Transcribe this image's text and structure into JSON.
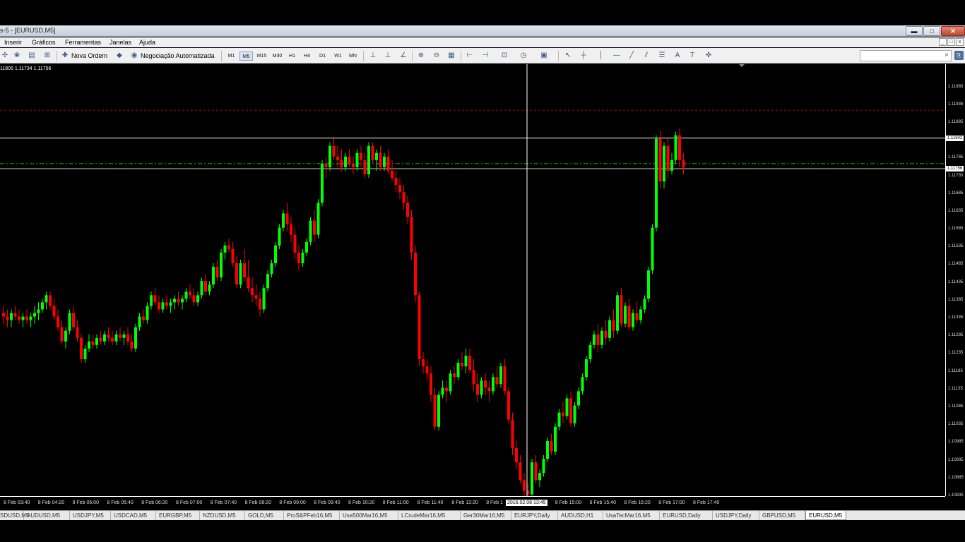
{
  "window": {
    "title": "s-5 - [EURUSD,M5]",
    "buttons": {
      "minimize": "▬",
      "maximize": "□",
      "close": "✕"
    }
  },
  "menu": {
    "items": [
      "Inserir",
      "Gráficos",
      "Ferramentas",
      "Janelas",
      "Ajuda"
    ],
    "mdi_buttons": [
      "_",
      "□",
      "x"
    ]
  },
  "toolbar": {
    "new_order": "Nova Ordem",
    "auto_trading": "Negociação Automatizada",
    "timeframes": [
      "M1",
      "M5",
      "M15",
      "M30",
      "H1",
      "H4",
      "D1",
      "W1",
      "MN"
    ],
    "active_timeframe": "M5",
    "icons": {
      "new-chart": "✢",
      "profiles": "❀",
      "market-watch": "▤",
      "navigator": "⊞",
      "new-order": "✚",
      "expert": "◆",
      "auto-trading": "◉",
      "bar-chart": "⊥",
      "candlesticks": "⊥",
      "line-chart": "∠",
      "zoom-in": "⊕",
      "zoom-out": "⊖",
      "tile-windows": "▦",
      "chart-shift": "⊢",
      "autoscroll": "⊣",
      "indicators": "⊡",
      "periods": "◷",
      "templates": "▣",
      "cursor": "↖",
      "crosshair": "┼",
      "vertical-line": "│",
      "horizontal-line": "—",
      "trendline": "╱",
      "equidistant-channel": "⫽",
      "fibonacci": "☰",
      "text": "A",
      "text-label": "T",
      "arrows": "✜",
      "search": "⌕",
      "signals": "⎘"
    }
  },
  "chart": {
    "ohlc": "11805 1.11734 1.11756",
    "crosshair_time": "2016.02.08 13:45",
    "price_tags": {
      "crosshair": "1.11842",
      "bid": "1.11756"
    }
  },
  "chart_data": {
    "type": "candlestick",
    "symbol": "EURUSD",
    "timeframe": "M5",
    "ylim": [
      1.10835,
      1.12
    ],
    "y_ticks": [
      "1.11985",
      "1.11935",
      "1.11885",
      "1.11785",
      "1.11735",
      "1.11685",
      "1.11635",
      "1.11585",
      "1.11535",
      "1.11485",
      "1.11435",
      "1.11385",
      "1.11335",
      "1.11285",
      "1.11235",
      "1.11185",
      "1.11135",
      "1.11085",
      "1.11035",
      "1.10985",
      "1.10935",
      "1.10885",
      "1.10835"
    ],
    "x_ticks": [
      "8 Feb 03:40",
      "8 Feb 04:20",
      "8 Feb 05:00",
      "8 Feb 05:40",
      "8 Feb 06:20",
      "8 Feb 07:00",
      "8 Feb 07:40",
      "8 Feb 08:20",
      "8 Feb 09:00",
      "8 Feb 09:40",
      "8 Feb 10:20",
      "8 Feb 11:00",
      "8 Feb 11:40",
      "8 Feb 12:20",
      "8 Feb 1",
      "8 Feb 14:20",
      "8 Feb 15:00",
      "8 Feb 15:40",
      "8 Feb 16:20",
      "8 Feb 17:00",
      "8 Feb 17:40"
    ],
    "lines": {
      "red_dashed": 1.1192,
      "crosshair_price": 1.11842,
      "green_dashdot": 1.1177,
      "bid": 1.11756
    },
    "colors": {
      "bull": "#00ff00",
      "bear": "#ff0000",
      "background": "#000000",
      "axis": "#ffffff"
    },
    "ohlc": [
      [
        1.1135,
        1.1137,
        1.1132,
        1.1134
      ],
      [
        1.1134,
        1.1136,
        1.1131,
        1.1133
      ],
      [
        1.1133,
        1.1136,
        1.1131,
        1.1135
      ],
      [
        1.1135,
        1.1137,
        1.1133,
        1.1134
      ],
      [
        1.1134,
        1.1136,
        1.1132,
        1.1133
      ],
      [
        1.1133,
        1.1135,
        1.1131,
        1.1134
      ],
      [
        1.1134,
        1.1136,
        1.1132,
        1.1133
      ],
      [
        1.1133,
        1.1135,
        1.1131,
        1.1134
      ],
      [
        1.1134,
        1.1137,
        1.1132,
        1.1135
      ],
      [
        1.1135,
        1.1138,
        1.1133,
        1.1136
      ],
      [
        1.1136,
        1.1139,
        1.1135,
        1.1138
      ],
      [
        1.1138,
        1.1141,
        1.1136,
        1.114
      ],
      [
        1.114,
        1.1141,
        1.1136,
        1.1137
      ],
      [
        1.1137,
        1.1139,
        1.1133,
        1.1134
      ],
      [
        1.1134,
        1.1136,
        1.113,
        1.1131
      ],
      [
        1.1131,
        1.1133,
        1.1126,
        1.1127
      ],
      [
        1.1127,
        1.1131,
        1.1125,
        1.113
      ],
      [
        1.113,
        1.1136,
        1.1129,
        1.1135
      ],
      [
        1.1135,
        1.1137,
        1.113,
        1.1131
      ],
      [
        1.1131,
        1.1133,
        1.1127,
        1.1128
      ],
      [
        1.1128,
        1.1129,
        1.1121,
        1.1122
      ],
      [
        1.1122,
        1.1126,
        1.1121,
        1.1125
      ],
      [
        1.1125,
        1.1129,
        1.1124,
        1.1127
      ],
      [
        1.1127,
        1.1129,
        1.1125,
        1.1126
      ],
      [
        1.1126,
        1.1129,
        1.1125,
        1.1128
      ],
      [
        1.1128,
        1.113,
        1.1126,
        1.1127
      ],
      [
        1.1127,
        1.113,
        1.1126,
        1.1129
      ],
      [
        1.1129,
        1.1131,
        1.1127,
        1.1128
      ],
      [
        1.1128,
        1.113,
        1.1126,
        1.1127
      ],
      [
        1.1127,
        1.113,
        1.1126,
        1.1129
      ],
      [
        1.1129,
        1.1131,
        1.1127,
        1.1128
      ],
      [
        1.1128,
        1.113,
        1.1126,
        1.1129
      ],
      [
        1.1129,
        1.1131,
        1.1126,
        1.1127
      ],
      [
        1.1127,
        1.1129,
        1.1124,
        1.1125
      ],
      [
        1.1125,
        1.1132,
        1.1124,
        1.1131
      ],
      [
        1.1131,
        1.1135,
        1.113,
        1.1134
      ],
      [
        1.1134,
        1.1136,
        1.1132,
        1.1133
      ],
      [
        1.1133,
        1.1138,
        1.1132,
        1.1137
      ],
      [
        1.1137,
        1.1141,
        1.1136,
        1.114
      ],
      [
        1.114,
        1.1142,
        1.1137,
        1.1138
      ],
      [
        1.1138,
        1.114,
        1.1135,
        1.1136
      ],
      [
        1.1136,
        1.1139,
        1.1135,
        1.1138
      ],
      [
        1.1138,
        1.114,
        1.1136,
        1.1137
      ],
      [
        1.1137,
        1.1139,
        1.1135,
        1.1138
      ],
      [
        1.1138,
        1.114,
        1.1136,
        1.1139
      ],
      [
        1.1139,
        1.1141,
        1.1137,
        1.1138
      ],
      [
        1.1138,
        1.114,
        1.1136,
        1.1139
      ],
      [
        1.1139,
        1.1142,
        1.1138,
        1.1141
      ],
      [
        1.1141,
        1.1143,
        1.1139,
        1.114
      ],
      [
        1.114,
        1.1142,
        1.1137,
        1.1138
      ],
      [
        1.1138,
        1.1141,
        1.1137,
        1.114
      ],
      [
        1.114,
        1.1145,
        1.1139,
        1.1144
      ],
      [
        1.1144,
        1.1146,
        1.114,
        1.1141
      ],
      [
        1.1141,
        1.1144,
        1.114,
        1.1143
      ],
      [
        1.1143,
        1.1149,
        1.1142,
        1.1148
      ],
      [
        1.1148,
        1.115,
        1.1144,
        1.1145
      ],
      [
        1.1145,
        1.1153,
        1.1144,
        1.1152
      ],
      [
        1.1152,
        1.1155,
        1.115,
        1.1154
      ],
      [
        1.1154,
        1.1156,
        1.1152,
        1.1153
      ],
      [
        1.1153,
        1.1155,
        1.1148,
        1.1149
      ],
      [
        1.1149,
        1.1151,
        1.1142,
        1.1143
      ],
      [
        1.1143,
        1.115,
        1.1142,
        1.1149
      ],
      [
        1.1149,
        1.1153,
        1.1144,
        1.1145
      ],
      [
        1.1145,
        1.115,
        1.1141,
        1.1142
      ],
      [
        1.1142,
        1.1145,
        1.1138,
        1.114
      ],
      [
        1.114,
        1.1143,
        1.1137,
        1.1139
      ],
      [
        1.1139,
        1.1141,
        1.1134,
        1.1136
      ],
      [
        1.1136,
        1.1143,
        1.1135,
        1.1142
      ],
      [
        1.1142,
        1.1147,
        1.1141,
        1.1146
      ],
      [
        1.1146,
        1.115,
        1.1145,
        1.1149
      ],
      [
        1.1149,
        1.1155,
        1.1148,
        1.1154
      ],
      [
        1.1154,
        1.116,
        1.1153,
        1.1159
      ],
      [
        1.1159,
        1.1164,
        1.1158,
        1.1163
      ],
      [
        1.1163,
        1.1166,
        1.1158,
        1.116
      ],
      [
        1.116,
        1.1162,
        1.1155,
        1.1157
      ],
      [
        1.1157,
        1.1159,
        1.115,
        1.1152
      ],
      [
        1.1152,
        1.1154,
        1.1147,
        1.1149
      ],
      [
        1.1149,
        1.1153,
        1.1148,
        1.1152
      ],
      [
        1.1152,
        1.1156,
        1.1151,
        1.1155
      ],
      [
        1.1155,
        1.1162,
        1.1154,
        1.1161
      ],
      [
        1.1161,
        1.1164,
        1.1155,
        1.1157
      ],
      [
        1.1157,
        1.1167,
        1.1156,
        1.1166
      ],
      [
        1.1166,
        1.1178,
        1.1165,
        1.1177
      ],
      [
        1.1177,
        1.1179,
        1.1173,
        1.1176
      ],
      [
        1.1176,
        1.1183,
        1.1175,
        1.1182
      ],
      [
        1.1182,
        1.1184,
        1.1178,
        1.1179
      ],
      [
        1.1179,
        1.1182,
        1.1176,
        1.1178
      ],
      [
        1.1178,
        1.1181,
        1.1175,
        1.1176
      ],
      [
        1.1176,
        1.118,
        1.1175,
        1.1179
      ],
      [
        1.1179,
        1.1181,
        1.1176,
        1.1177
      ],
      [
        1.1177,
        1.1179,
        1.1174,
        1.1176
      ],
      [
        1.1176,
        1.1181,
        1.1175,
        1.118
      ],
      [
        1.118,
        1.1182,
        1.1176,
        1.1178
      ],
      [
        1.1178,
        1.118,
        1.1173,
        1.1174
      ],
      [
        1.1174,
        1.1183,
        1.1173,
        1.1182
      ],
      [
        1.1182,
        1.1183,
        1.1177,
        1.1178
      ],
      [
        1.1178,
        1.1181,
        1.1175,
        1.118
      ],
      [
        1.118,
        1.1182,
        1.1175,
        1.1176
      ],
      [
        1.1176,
        1.118,
        1.1175,
        1.1179
      ],
      [
        1.1179,
        1.1181,
        1.1174,
        1.1175
      ],
      [
        1.1175,
        1.1178,
        1.1172,
        1.1173
      ],
      [
        1.1173,
        1.1175,
        1.1169,
        1.1171
      ],
      [
        1.1171,
        1.1173,
        1.1167,
        1.1169
      ],
      [
        1.1169,
        1.1171,
        1.1164,
        1.1166
      ],
      [
        1.1166,
        1.1168,
        1.116,
        1.1162
      ],
      [
        1.1162,
        1.1164,
        1.115,
        1.1152
      ],
      [
        1.1152,
        1.1154,
        1.1138,
        1.114
      ],
      [
        1.114,
        1.1141,
        1.112,
        1.1122
      ],
      [
        1.1122,
        1.1124,
        1.1118,
        1.112
      ],
      [
        1.112,
        1.1122,
        1.1116,
        1.1118
      ],
      [
        1.1118,
        1.112,
        1.111,
        1.1112
      ],
      [
        1.1112,
        1.1114,
        1.1102,
        1.1103
      ],
      [
        1.1103,
        1.1113,
        1.1102,
        1.1112
      ],
      [
        1.1112,
        1.1116,
        1.1111,
        1.1114
      ],
      [
        1.1114,
        1.1116,
        1.111,
        1.1113
      ],
      [
        1.1113,
        1.1119,
        1.1112,
        1.1118
      ],
      [
        1.1118,
        1.112,
        1.1115,
        1.1117
      ],
      [
        1.1117,
        1.1122,
        1.1116,
        1.1121
      ],
      [
        1.1121,
        1.1124,
        1.1119,
        1.112
      ],
      [
        1.112,
        1.1125,
        1.1118,
        1.1123
      ],
      [
        1.1123,
        1.1125,
        1.1118,
        1.1119
      ],
      [
        1.1119,
        1.1122,
        1.1113,
        1.1115
      ],
      [
        1.1115,
        1.1118,
        1.111,
        1.1112
      ],
      [
        1.1112,
        1.1117,
        1.1111,
        1.1116
      ],
      [
        1.1116,
        1.1118,
        1.1112,
        1.1114
      ],
      [
        1.1114,
        1.1116,
        1.111,
        1.1113
      ],
      [
        1.1113,
        1.1118,
        1.1112,
        1.1117
      ],
      [
        1.1117,
        1.112,
        1.1114,
        1.1115
      ],
      [
        1.1115,
        1.1121,
        1.1114,
        1.112
      ],
      [
        1.112,
        1.1122,
        1.1112,
        1.1113
      ],
      [
        1.1113,
        1.1114,
        1.1104,
        1.1105
      ],
      [
        1.1105,
        1.1107,
        1.1095,
        1.1097
      ],
      [
        1.1097,
        1.1099,
        1.1091,
        1.1093
      ],
      [
        1.1093,
        1.1095,
        1.1087,
        1.1088
      ],
      [
        1.1088,
        1.109,
        1.1083,
        1.1085
      ],
      [
        1.1085,
        1.1087,
        1.1082,
        1.1084
      ],
      [
        1.1084,
        1.1094,
        1.1083,
        1.1093
      ],
      [
        1.1093,
        1.1095,
        1.1087,
        1.1088
      ],
      [
        1.1088,
        1.1091,
        1.1086,
        1.109
      ],
      [
        1.109,
        1.1095,
        1.1089,
        1.1094
      ],
      [
        1.1094,
        1.11,
        1.1093,
        1.1099
      ],
      [
        1.1099,
        1.1101,
        1.1095,
        1.1096
      ],
      [
        1.1096,
        1.1104,
        1.1095,
        1.1103
      ],
      [
        1.1103,
        1.1108,
        1.1102,
        1.1107
      ],
      [
        1.1107,
        1.111,
        1.1104,
        1.1106
      ],
      [
        1.1106,
        1.1112,
        1.1105,
        1.1111
      ],
      [
        1.1111,
        1.1113,
        1.1103,
        1.1104
      ],
      [
        1.1104,
        1.111,
        1.1103,
        1.1109
      ],
      [
        1.1109,
        1.1114,
        1.1108,
        1.1113
      ],
      [
        1.1113,
        1.1118,
        1.1112,
        1.1117
      ],
      [
        1.1117,
        1.1123,
        1.1116,
        1.1122
      ],
      [
        1.1122,
        1.1127,
        1.1121,
        1.1126
      ],
      [
        1.1126,
        1.113,
        1.1125,
        1.1129
      ],
      [
        1.1129,
        1.1132,
        1.1124,
        1.1126
      ],
      [
        1.1126,
        1.1131,
        1.1125,
        1.113
      ],
      [
        1.113,
        1.1133,
        1.1126,
        1.1128
      ],
      [
        1.1128,
        1.1134,
        1.1127,
        1.1133
      ],
      [
        1.1133,
        1.1136,
        1.1128,
        1.113
      ],
      [
        1.113,
        1.1141,
        1.1129,
        1.114
      ],
      [
        1.114,
        1.1142,
        1.1131,
        1.1132
      ],
      [
        1.1132,
        1.1138,
        1.1131,
        1.1137
      ],
      [
        1.1137,
        1.1139,
        1.113,
        1.1131
      ],
      [
        1.1131,
        1.1136,
        1.113,
        1.1135
      ],
      [
        1.1135,
        1.1138,
        1.1132,
        1.1133
      ],
      [
        1.1133,
        1.1137,
        1.1132,
        1.1136
      ],
      [
        1.1136,
        1.114,
        1.1135,
        1.1139
      ],
      [
        1.1139,
        1.1148,
        1.1138,
        1.1147
      ],
      [
        1.1147,
        1.116,
        1.1146,
        1.1159
      ],
      [
        1.1159,
        1.1185,
        1.1158,
        1.1184
      ],
      [
        1.1184,
        1.1186,
        1.117,
        1.1172
      ],
      [
        1.1172,
        1.1183,
        1.117,
        1.1182
      ],
      [
        1.1182,
        1.1184,
        1.1173,
        1.1175
      ],
      [
        1.1175,
        1.118,
        1.1174,
        1.1178
      ],
      [
        1.1178,
        1.1186,
        1.1177,
        1.1185
      ],
      [
        1.1185,
        1.1187,
        1.1176,
        1.1178
      ],
      [
        1.1178,
        1.118,
        1.1174,
        1.1176
      ]
    ]
  },
  "tabs": {
    "items": [
      "SDUSD,M5",
      "AUDUSD,M5",
      "USDJPY,M5",
      "USDCAD,M5",
      "EURGBP,M5",
      "NZDUSD,M5",
      "GOLD,M5",
      "ProS&PFeb16,M5",
      "Usa500Mar16,M5",
      "LCrudeMar16,M5",
      "Ger30Mar16,M5",
      "EURJPY,Daily",
      "AUDUSD,H1",
      "UsaTecMar16,M5",
      "EURUSD,Daily",
      "USDJPY,Daily",
      "GBPUSD,M5",
      "EURUSD,M5"
    ],
    "active": "EURUSD,M5"
  }
}
